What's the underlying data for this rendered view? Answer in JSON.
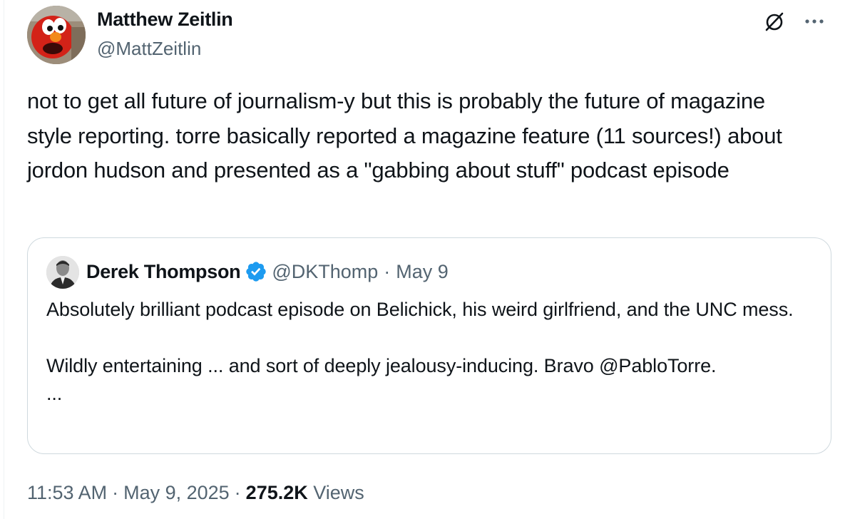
{
  "tweet": {
    "author": {
      "name": "Matthew Zeitlin",
      "handle": "@MattZeitlin",
      "avatar": "elmo-avatar"
    },
    "text": "not to get all future of journalism-y but this is probably the future of magazine style reporting. torre basically reported a magazine feature (11 sources!) about jordon hudson and presented as a \"gabbing about stuff\" podcast episode",
    "icons": {
      "grok": "grok-icon",
      "more": "more-icon"
    },
    "quote": {
      "author": {
        "name": "Derek Thompson",
        "verified": true,
        "handle": "@DKThomp",
        "separator": "·",
        "date": "May 9",
        "avatar": "portrait-avatar"
      },
      "text": "Absolutely brilliant podcast episode on Belichick, his weird girlfriend, and the UNC mess.\n\nWildly entertaining ... and sort of deeply jealousy-inducing. Bravo @PabloTorre.\n..."
    },
    "meta": {
      "time": "11:53 AM",
      "separator": "·",
      "date": "May 9, 2025",
      "views_count": "275.2K",
      "views_label": "Views"
    }
  },
  "colors": {
    "text_primary": "#0f1419",
    "text_secondary": "#536471",
    "border": "#cfd9de",
    "verified_blue": "#1d9bf0"
  }
}
